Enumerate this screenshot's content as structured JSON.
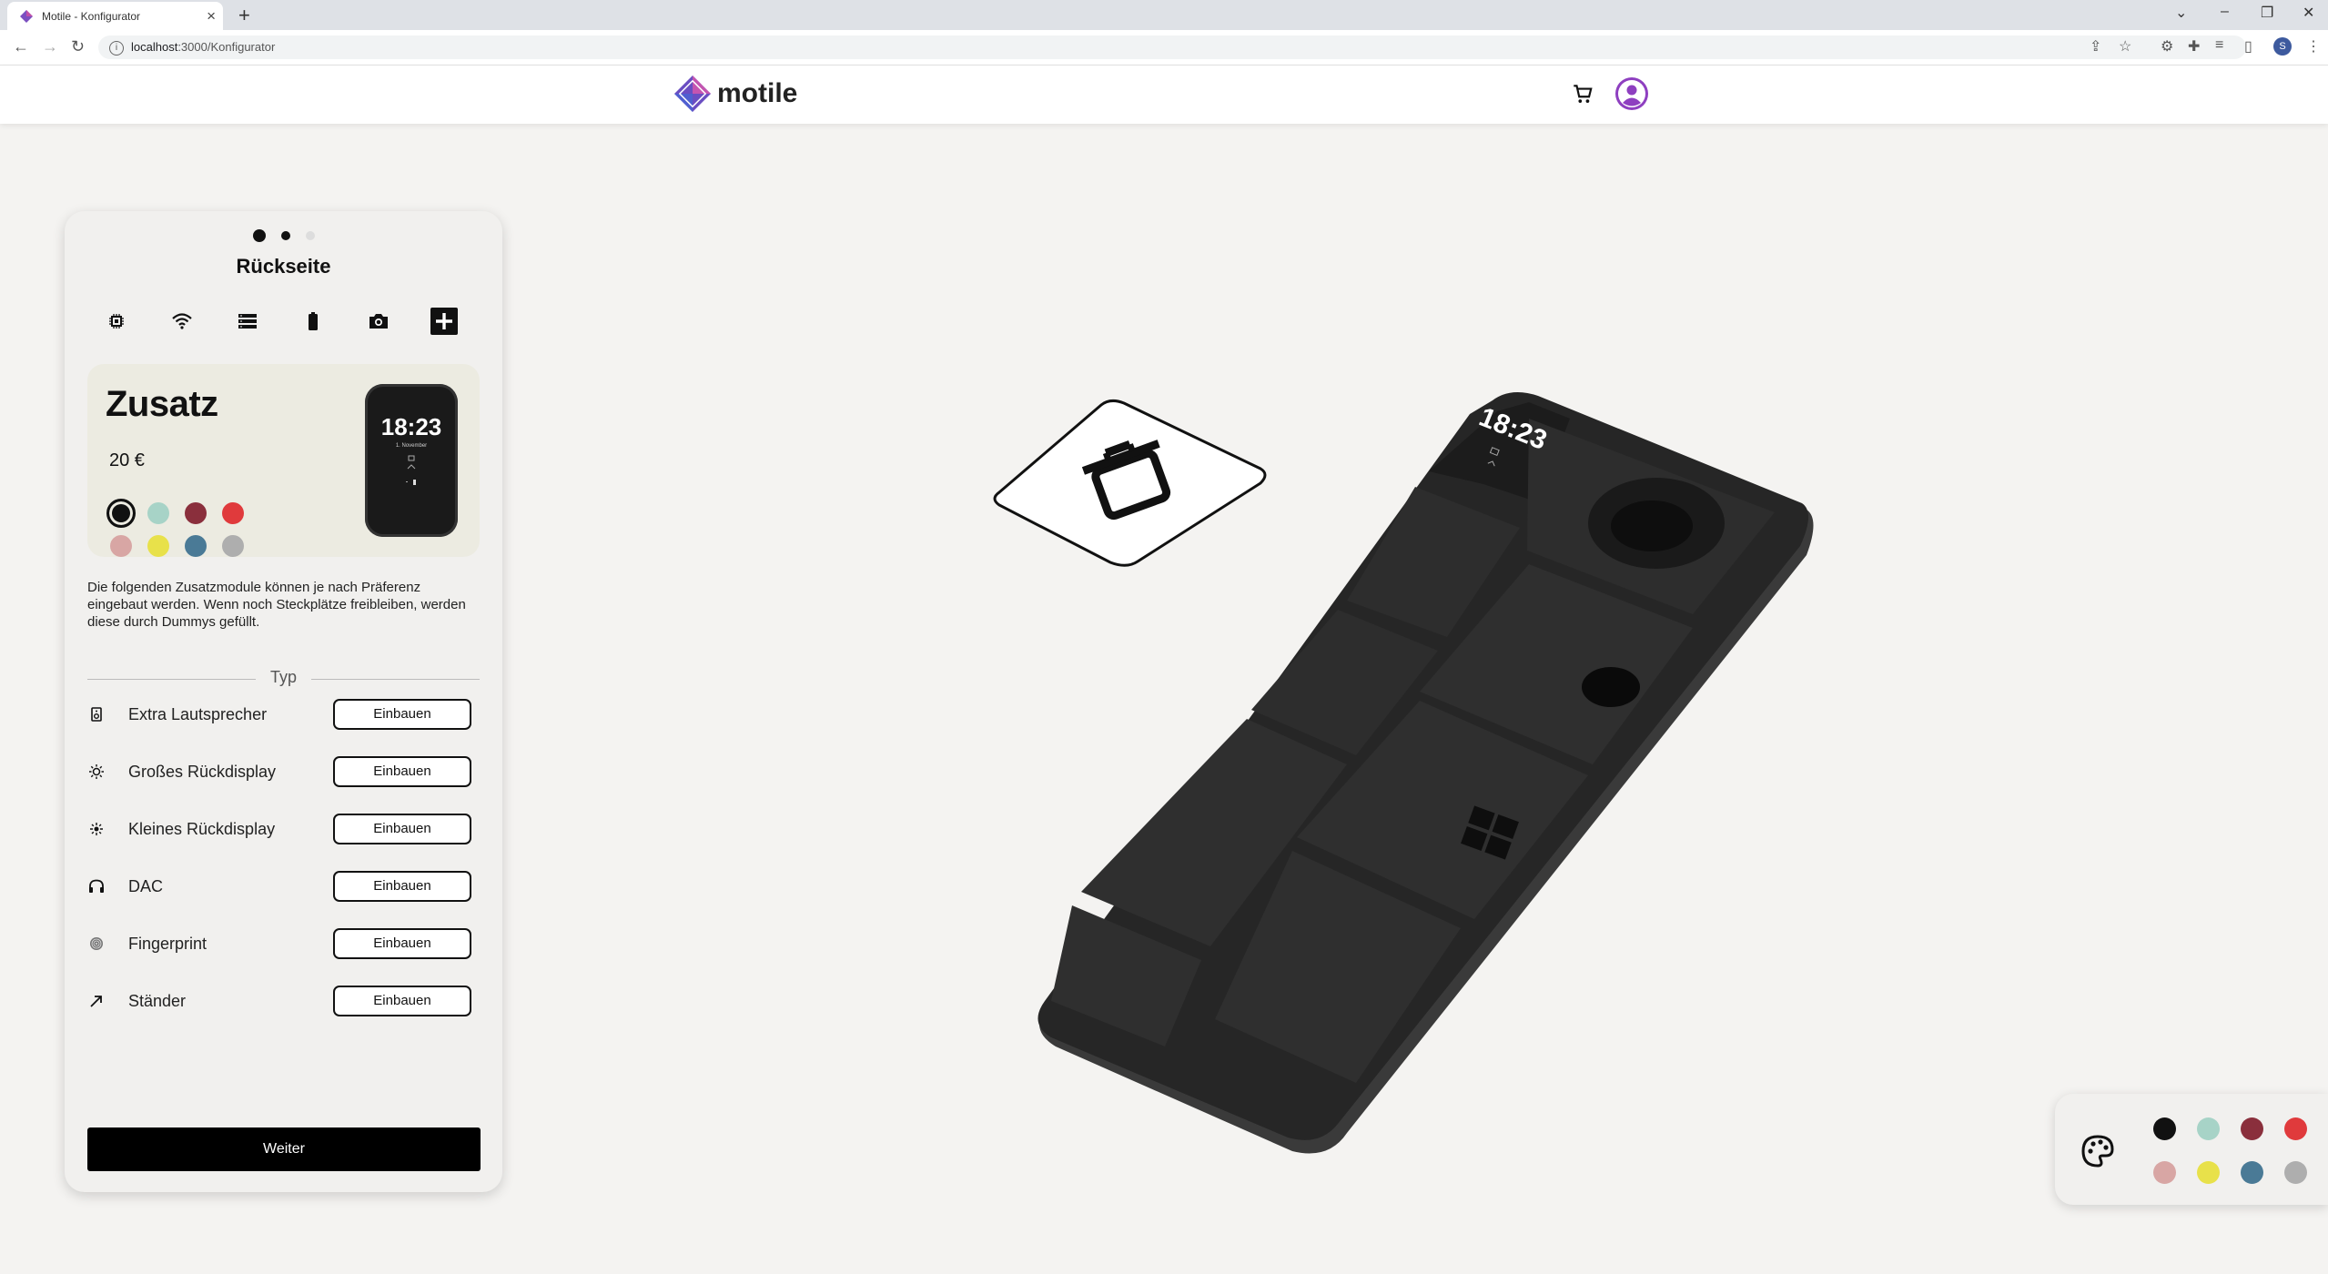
{
  "browser": {
    "tab_title": "Motile - Konfigurator",
    "new_tab": "+",
    "url_host": "localhost",
    "url_rest": ":3000/Konfigurator",
    "profile_initial": "S"
  },
  "header": {
    "logo_text": "motile"
  },
  "panel": {
    "step_title": "Rückseite",
    "categories": [
      "chip-icon",
      "wifi-icon",
      "storage-icon",
      "battery-icon",
      "camera-icon",
      "plus-icon"
    ],
    "product": {
      "name": "Zusatz",
      "price": "20 €",
      "colors": [
        "#111111",
        "#a7d3c7",
        "#8a2f3c",
        "#e03a3c",
        "#d8a6a4",
        "#e8e14a",
        "#4a7a96",
        "#aeaeae"
      ],
      "selected_color": 0,
      "preview_time": "18:23",
      "preview_date": "1. November"
    },
    "description": "Die folgenden Zusatzmodule können je nach Präferenz eingebaut werden. Wenn noch Steckplätze freibleiben, werden diese durch Dummys gefüllt.",
    "section_label": "Typ",
    "modules": [
      {
        "label": "Extra Lautsprecher",
        "icon": "speaker-icon",
        "button": "Einbauen"
      },
      {
        "label": "Großes Rückdisplay",
        "icon": "brightness-icon",
        "button": "Einbauen"
      },
      {
        "label": "Kleines Rückdisplay",
        "icon": "brightness-small-icon",
        "button": "Einbauen"
      },
      {
        "label": "DAC",
        "icon": "headphones-icon",
        "button": "Einbauen"
      },
      {
        "label": "Fingerprint",
        "icon": "fingerprint-icon",
        "button": "Einbauen"
      },
      {
        "label": "Ständer",
        "icon": "arrow-up-right-icon",
        "button": "Einbauen"
      }
    ],
    "next_button": "Weiter"
  },
  "viewer": {
    "phone_time": "18:23",
    "trash_icon": "trash-icon"
  },
  "palette": {
    "icon": "palette-icon",
    "colors": [
      "#111111",
      "#a7d3c7",
      "#8a2f3c",
      "#e03a3c",
      "#d8a6a4",
      "#e8e14a",
      "#4a7a96",
      "#aeaeae"
    ]
  }
}
